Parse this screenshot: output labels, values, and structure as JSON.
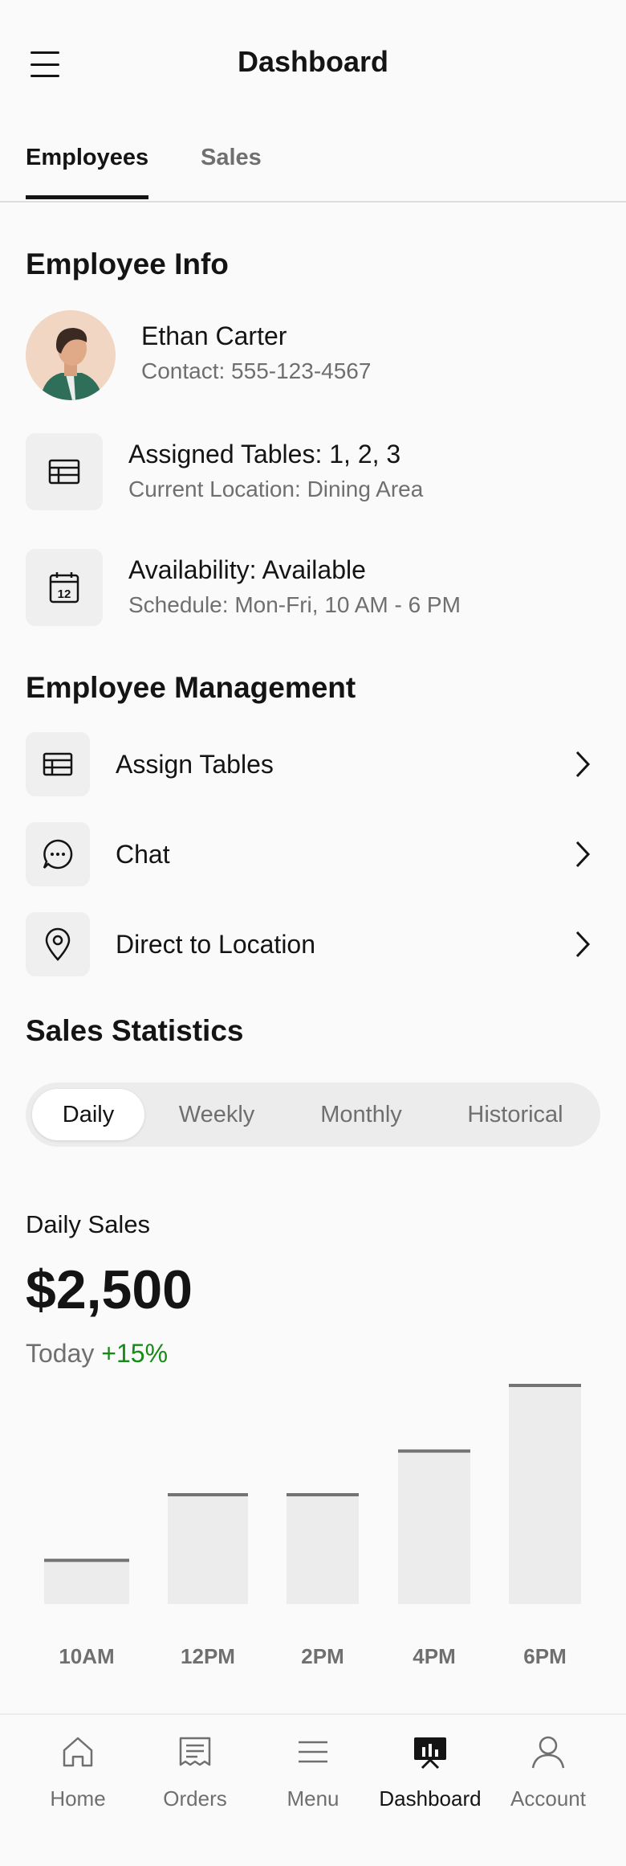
{
  "header": {
    "title": "Dashboard",
    "menu_icon": "hamburger-menu-icon"
  },
  "tabs": [
    {
      "label": "Employees",
      "active": true
    },
    {
      "label": "Sales",
      "active": false
    }
  ],
  "employee_info": {
    "title": "Employee Info",
    "name": "Ethan Carter",
    "contact": "Contact: 555-123-4567",
    "rows": [
      {
        "icon": "table-icon",
        "main": "Assigned Tables: 1, 2, 3",
        "sub": "Current Location: Dining Area"
      },
      {
        "icon": "calendar-icon",
        "main": "Availability: Available",
        "sub": "Schedule: Mon-Fri, 10 AM - 6 PM"
      }
    ]
  },
  "management": {
    "title": "Employee Management",
    "items": [
      {
        "icon": "table-icon",
        "label": "Assign Tables"
      },
      {
        "icon": "chat-icon",
        "label": "Chat"
      },
      {
        "icon": "location-pin-icon",
        "label": "Direct to Location"
      }
    ]
  },
  "sales": {
    "title": "Sales Statistics",
    "periods": [
      "Daily",
      "Weekly",
      "Monthly",
      "Historical"
    ],
    "selected_period": "Daily",
    "label": "Daily Sales",
    "value": "$2,500",
    "period_text": "Today",
    "change": "+15%",
    "colors": {
      "positive": "#178a17",
      "bar_fill": "#ececec",
      "bar_top": "#737373"
    }
  },
  "chart_data": {
    "type": "bar",
    "categories": [
      "10AM",
      "12PM",
      "2PM",
      "4PM",
      "6PM"
    ],
    "values": [
      20,
      50,
      50,
      70,
      100
    ],
    "ylim": [
      0,
      100
    ],
    "grid": false
  },
  "bottom_nav": [
    {
      "label": "Home",
      "icon": "home-icon",
      "active": false
    },
    {
      "label": "Orders",
      "icon": "orders-icon",
      "active": false
    },
    {
      "label": "Menu",
      "icon": "menu-icon",
      "active": false
    },
    {
      "label": "Dashboard",
      "icon": "dashboard-icon",
      "active": true
    },
    {
      "label": "Account",
      "icon": "account-icon",
      "active": false
    }
  ]
}
